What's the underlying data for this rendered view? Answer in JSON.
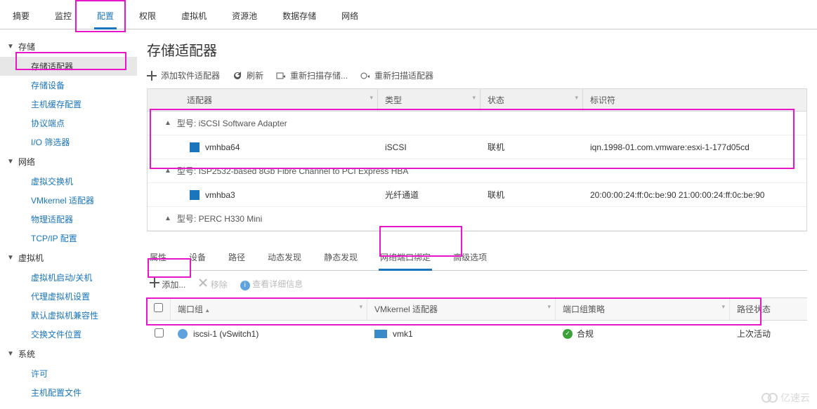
{
  "top_tabs": {
    "items": [
      "摘要",
      "监控",
      "配置",
      "权限",
      "虚拟机",
      "资源池",
      "数据存储",
      "网络"
    ],
    "active_index": 2
  },
  "sidebar": {
    "groups": [
      {
        "title": "存储",
        "expanded": true,
        "items": [
          "存储适配器",
          "存储设备",
          "主机缓存配置",
          "协议端点",
          "I/O 筛选器"
        ],
        "active_index": 0
      },
      {
        "title": "网络",
        "expanded": true,
        "items": [
          "虚拟交换机",
          "VMkernel 适配器",
          "物理适配器",
          "TCP/IP 配置"
        ]
      },
      {
        "title": "虚拟机",
        "expanded": true,
        "items": [
          "虚拟机启动/关机",
          "代理虚拟机设置",
          "默认虚拟机兼容性",
          "交换文件位置"
        ]
      },
      {
        "title": "系统",
        "expanded": true,
        "items": [
          "许可",
          "主机配置文件"
        ]
      }
    ]
  },
  "page": {
    "title": "存储适配器"
  },
  "toolbar": {
    "add_adapter": "添加软件适配器",
    "refresh": "刷新",
    "rescan_storage": "重新扫描存储...",
    "rescan_adapter": "重新扫描适配器"
  },
  "adapter_grid": {
    "columns": {
      "adapter": "适配器",
      "type": "类型",
      "status": "状态",
      "id": "标识符"
    },
    "groups": [
      {
        "label": "型号: iSCSI Software Adapter",
        "expanded": true,
        "rows": [
          {
            "adapter": "vmhba64",
            "type": "iSCSI",
            "status": "联机",
            "id": "iqn.1998-01.com.vmware:esxi-1-177d05cd"
          }
        ]
      },
      {
        "label": "型号: ISP2532-based 8Gb Fibre Channel to PCI Express HBA",
        "expanded": true,
        "rows": [
          {
            "adapter": "vmhba3",
            "type": "光纤通道",
            "status": "联机",
            "id": "20:00:00:24:ff:0c:be:90 21:00:00:24:ff:0c:be:90"
          }
        ]
      },
      {
        "label": "型号: PERC H330 Mini",
        "expanded": true,
        "rows": []
      }
    ]
  },
  "sub_tabs": {
    "items": [
      "属性",
      "设备",
      "路径",
      "动态发现",
      "静态发现",
      "网络端口绑定",
      "高级选项"
    ],
    "active_index": 5
  },
  "sub_toolbar": {
    "add": "添加...",
    "remove": "移除",
    "details": "查看详细信息"
  },
  "binding_grid": {
    "columns": {
      "portgroup": "端口组",
      "vmk": "VMkernel 适配器",
      "policy": "端口组策略",
      "path": "路径状态"
    },
    "rows": [
      {
        "portgroup": "iscsi-1 (vSwitch1)",
        "vmk": "vmk1",
        "policy": "合规",
        "path": "上次活动"
      }
    ]
  },
  "watermark": "亿速云"
}
